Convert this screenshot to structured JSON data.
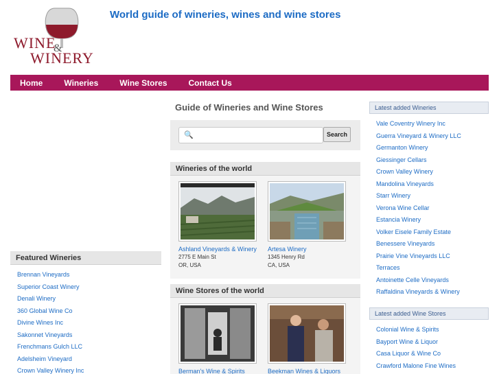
{
  "logo": {
    "line1": "WINE",
    "ampersand": "&",
    "line2": "WINERY"
  },
  "tagline": "World guide of wineries, wines and wine stores",
  "nav": {
    "items": [
      "Home",
      "Wineries",
      "Wine Stores",
      "Contact Us"
    ]
  },
  "center": {
    "title": "Guide of Wineries and Wine Stores",
    "search": {
      "placeholder": "",
      "value": "",
      "button": "Search",
      "icon": "magnifier-icon"
    },
    "wineries_section": {
      "heading": "Wineries of the world",
      "items": [
        {
          "name": "Ashland Vineyards & Winery",
          "address1": "2775 E Main St",
          "address2": "OR, USA"
        },
        {
          "name": "Artesa Winery",
          "address1": "1345 Henry Rd",
          "address2": "CA, USA"
        }
      ]
    },
    "stores_section": {
      "heading": "Wine Stores of the world",
      "items": [
        {
          "name": "Berman's Wine & Spirits"
        },
        {
          "name": "Beekman Wines & Liquors"
        }
      ]
    }
  },
  "featured": {
    "heading": "Featured Wineries",
    "items": [
      "Brennan Vineyards",
      "Superior Coast Winery",
      "Denali Winery",
      "360 Global Wine Co",
      "Divine Wines Inc",
      "Sakonnet Vineyards",
      "Frenchmans Gulch LLC",
      "Adelsheim Vineyard",
      "Crown Valley Winery Inc"
    ]
  },
  "latest_wineries": {
    "heading": "Latest added Wineries",
    "items": [
      "Vale Coventry Winery Inc",
      "Guerra Vineyard & Winery LLC",
      "Germanton Winery",
      "Giessinger Cellars",
      "Crown Valley Winery",
      "Mandolina Vineyards",
      "Starr Winery",
      "Verona Wine Cellar",
      "Estancia Winery",
      "Volker Eisele Family Estate",
      "Benessere Vineyards",
      "Prairie Vine Vineyards LLC",
      "Terraces",
      "Antoinette Celle Vineyards",
      "Raffaldina Vineyards & Winery"
    ]
  },
  "latest_stores": {
    "heading": "Latest added Wine Stores",
    "items": [
      "Colonial Wine & Spirits",
      "Bayport Wine & Liquor",
      "Casa Liquor & Wine Co",
      "Crawford Malone Fine Wines"
    ]
  },
  "colors": {
    "nav_bg": "#a8175a",
    "link": "#1c6bc4",
    "tagline": "#1c6bc4",
    "wine": "#8e1a2c"
  }
}
